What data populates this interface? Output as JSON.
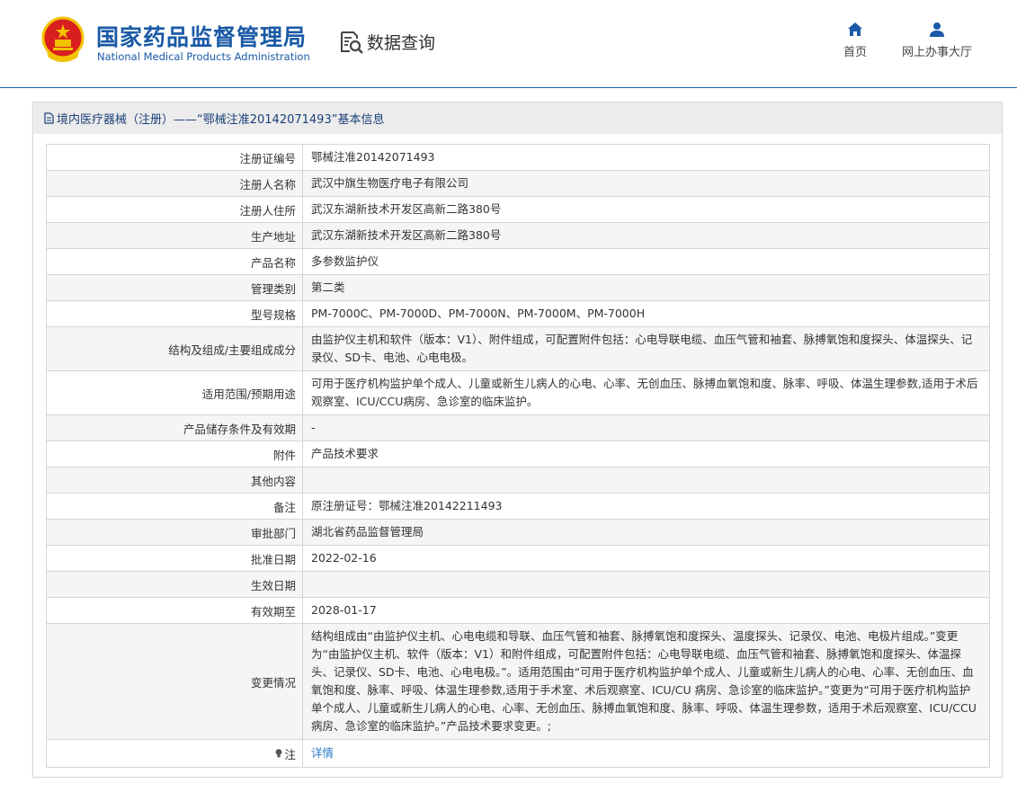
{
  "header": {
    "brand_cn": "国家药品监督管理局",
    "brand_en": "National Medical Products Administration",
    "query_label": "数据查询",
    "nav": [
      {
        "label": "首页",
        "icon": "home-icon"
      },
      {
        "label": "网上办事大厅",
        "icon": "user-icon"
      }
    ]
  },
  "colors": {
    "brand": "#1a5aa6",
    "header_line": "#1c5fa8",
    "link": "#2a7ac8",
    "logo_red": "#d81e1e",
    "logo_gold": "#f2c200"
  },
  "panel": {
    "title": "境内医疗器械（注册）——“鄂械注准20142071493”基本信息"
  },
  "fields": [
    {
      "label": "注册证编号",
      "value": "鄂械注准20142071493"
    },
    {
      "label": "注册人名称",
      "value": "武汉中旗生物医疗电子有限公司"
    },
    {
      "label": "注册人住所",
      "value": "武汉东湖新技术开发区高新二路380号"
    },
    {
      "label": "生产地址",
      "value": "武汉东湖新技术开发区高新二路380号"
    },
    {
      "label": "产品名称",
      "value": "多参数监护仪"
    },
    {
      "label": "管理类别",
      "value": "第二类"
    },
    {
      "label": "型号规格",
      "value": "PM-7000C、PM-7000D、PM-7000N、PM-7000M、PM-7000H"
    },
    {
      "label": "结构及组成/主要组成成分",
      "value": "由监护仪主机和软件（版本：V1）、附件组成，可配置附件包括：心电导联电缆、血压气管和袖套、脉搏氧饱和度探头、体温探头、记录仪、SD卡、电池、心电电极。"
    },
    {
      "label": "适用范围/预期用途",
      "value": "可用于医疗机构监护单个成人、儿童或新生儿病人的心电、心率、无创血压、脉搏血氧饱和度、脉率、呼吸、体温生理参数,适用于术后观察室、ICU/CCU病房、急诊室的临床监护。"
    },
    {
      "label": "产品储存条件及有效期",
      "value": "-"
    },
    {
      "label": "附件",
      "value": "产品技术要求"
    },
    {
      "label": "其他内容",
      "value": ""
    },
    {
      "label": "备注",
      "value": "原注册证号：鄂械注准20142211493"
    },
    {
      "label": "审批部门",
      "value": "湖北省药品监督管理局"
    },
    {
      "label": "批准日期",
      "value": "2022-02-16"
    },
    {
      "label": "生效日期",
      "value": ""
    },
    {
      "label": "有效期至",
      "value": "2028-01-17"
    },
    {
      "label": "变更情况",
      "value": "结构组成由“由监护仪主机、心电电缆和导联、血压气管和袖套、脉搏氧饱和度探头、温度探头、记录仪、电池、电极片组成。”变更为“由监护仪主机、软件（版本：V1）和附件组成，可配置附件包括：心电导联电缆、血压气管和袖套、脉搏氧饱和度探头、体温探头、记录仪、SD卡、电池、心电电极。”。适用范围由“可用于医疗机构监护单个成人、儿童或新生儿病人的心电、心率、无创血压、血氧饱和度、脉率、呼吸、体温生理参数,适用于手术室、术后观察室、ICU/CU 病房、急诊室的临床监护。”变更为“可用于医疗机构监护单个成人、儿童或新生儿病人的心电、心率、无创血压、脉搏血氧饱和度、脉率、呼吸、体温生理参数，适用于术后观察室、ICU/CCU 病房、急诊室的临床监护。”产品技术要求变更。;"
    }
  ],
  "note": {
    "label": "注",
    "link_text": "详情",
    "icon": "lightbulb-icon"
  }
}
